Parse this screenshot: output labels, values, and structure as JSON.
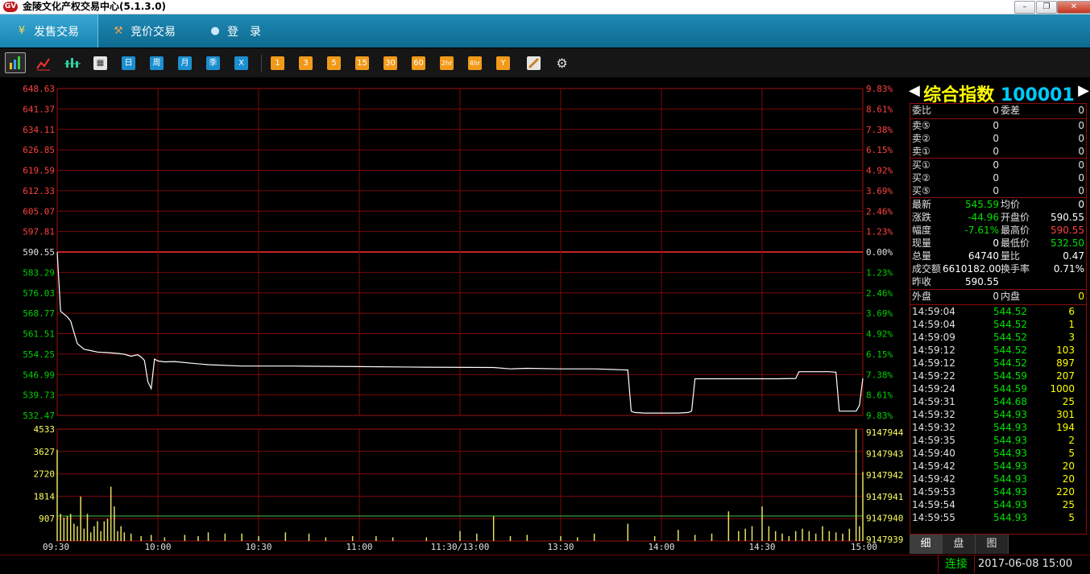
{
  "window": {
    "title": "金陵文化产权交易中心(5.1.3.0)"
  },
  "nav": {
    "tabs": [
      {
        "label": "发售交易",
        "icon": "yen-icon"
      },
      {
        "label": "竞价交易",
        "icon": "gavel-icon"
      },
      {
        "label": "登　录",
        "icon": "user-icon"
      }
    ]
  },
  "toolbar": {
    "periods": [
      "日",
      "周",
      "月",
      "季",
      "X"
    ],
    "minutes": [
      "1",
      "3",
      "5",
      "15",
      "30",
      "60",
      "2hr",
      "4hr",
      "Y"
    ]
  },
  "chart_data": {
    "type": "line",
    "price_axis": {
      "left_labels": [
        "648.63",
        "641.37",
        "634.11",
        "626.85",
        "619.59",
        "612.33",
        "605.07",
        "597.81",
        "590.55",
        "583.29",
        "576.03",
        "568.77",
        "561.51",
        "554.25",
        "546.99",
        "539.73",
        "532.47"
      ],
      "right_labels": [
        "9.83%",
        "8.61%",
        "7.38%",
        "6.15%",
        "4.92%",
        "3.69%",
        "2.46%",
        "1.23%",
        "0.00%",
        "1.23%",
        "2.46%",
        "3.69%",
        "4.92%",
        "6.15%",
        "7.38%",
        "8.61%",
        "9.83%"
      ],
      "ylim": [
        532.47,
        648.63
      ],
      "prev_close": 590.55
    },
    "volume_axis": {
      "left_labels": [
        "4533",
        "3627",
        "2720",
        "1814",
        "907"
      ],
      "right_labels": [
        "9147944",
        "9147943",
        "9147942",
        "9147941",
        "9147940",
        "9147939"
      ],
      "ylim": [
        0,
        4533
      ]
    },
    "x_labels": [
      "09:30",
      "10:00",
      "10:30",
      "11:00",
      "11:30/13:00",
      "13:30",
      "14:00",
      "14:30",
      "15:00"
    ],
    "n_minutes": 240,
    "price_series": [
      [
        0,
        590.5
      ],
      [
        1,
        569.5
      ],
      [
        2,
        568.5
      ],
      [
        3,
        567.5
      ],
      [
        4,
        566
      ],
      [
        5,
        562
      ],
      [
        6,
        558
      ],
      [
        8,
        556
      ],
      [
        10,
        555.5
      ],
      [
        12,
        555
      ],
      [
        15,
        554.8
      ],
      [
        18,
        554.5
      ],
      [
        20,
        554.2
      ],
      [
        22,
        553.5
      ],
      [
        24,
        554
      ],
      [
        25,
        553.2
      ],
      [
        26,
        552
      ],
      [
        27,
        544.5
      ],
      [
        28,
        542
      ],
      [
        29,
        552.5
      ],
      [
        30,
        551.8
      ],
      [
        32,
        551.5
      ],
      [
        35,
        551.6
      ],
      [
        40,
        551
      ],
      [
        45,
        550.5
      ],
      [
        55,
        550
      ],
      [
        70,
        550
      ],
      [
        90,
        549.8
      ],
      [
        110,
        549.6
      ],
      [
        130,
        549.5
      ],
      [
        135,
        549
      ],
      [
        140,
        549.2
      ],
      [
        150,
        549
      ],
      [
        160,
        549
      ],
      [
        168,
        548.7
      ],
      [
        170,
        548.6
      ],
      [
        171,
        534
      ],
      [
        172,
        533.5
      ],
      [
        175,
        533.3
      ],
      [
        185,
        533.3
      ],
      [
        188,
        533.5
      ],
      [
        189,
        534
      ],
      [
        190,
        545.5
      ],
      [
        200,
        545.5
      ],
      [
        215,
        545.5
      ],
      [
        220,
        545.6
      ],
      [
        221,
        548
      ],
      [
        230,
        548
      ],
      [
        232,
        547.8
      ],
      [
        233,
        534
      ],
      [
        238,
        534
      ],
      [
        239,
        536
      ],
      [
        240,
        545.6
      ]
    ],
    "volume_series": [
      [
        0,
        3700
      ],
      [
        1,
        1100
      ],
      [
        2,
        950
      ],
      [
        3,
        1000
      ],
      [
        4,
        1100
      ],
      [
        5,
        700
      ],
      [
        6,
        600
      ],
      [
        7,
        1800
      ],
      [
        8,
        500
      ],
      [
        9,
        1100
      ],
      [
        10,
        350
      ],
      [
        11,
        600
      ],
      [
        12,
        800
      ],
      [
        13,
        400
      ],
      [
        14,
        800
      ],
      [
        15,
        900
      ],
      [
        16,
        2200
      ],
      [
        17,
        1400
      ],
      [
        18,
        400
      ],
      [
        19,
        600
      ],
      [
        20,
        350
      ],
      [
        22,
        300
      ],
      [
        25,
        200
      ],
      [
        28,
        250
      ],
      [
        32,
        150
      ],
      [
        38,
        250
      ],
      [
        42,
        200
      ],
      [
        45,
        350
      ],
      [
        50,
        300
      ],
      [
        55,
        300
      ],
      [
        60,
        200
      ],
      [
        68,
        350
      ],
      [
        75,
        300
      ],
      [
        80,
        150
      ],
      [
        88,
        200
      ],
      [
        95,
        200
      ],
      [
        100,
        150
      ],
      [
        110,
        150
      ],
      [
        120,
        400
      ],
      [
        125,
        300
      ],
      [
        130,
        1000
      ],
      [
        135,
        200
      ],
      [
        140,
        250
      ],
      [
        150,
        200
      ],
      [
        155,
        150
      ],
      [
        160,
        300
      ],
      [
        170,
        700
      ],
      [
        178,
        200
      ],
      [
        185,
        450
      ],
      [
        190,
        250
      ],
      [
        195,
        300
      ],
      [
        200,
        1200
      ],
      [
        203,
        400
      ],
      [
        205,
        500
      ],
      [
        207,
        600
      ],
      [
        210,
        1400
      ],
      [
        212,
        600
      ],
      [
        214,
        400
      ],
      [
        216,
        300
      ],
      [
        218,
        200
      ],
      [
        220,
        400
      ],
      [
        222,
        500
      ],
      [
        224,
        400
      ],
      [
        226,
        300
      ],
      [
        228,
        600
      ],
      [
        230,
        400
      ],
      [
        232,
        350
      ],
      [
        234,
        300
      ],
      [
        236,
        500
      ],
      [
        238,
        4533
      ],
      [
        239,
        600
      ],
      [
        240,
        2800
      ]
    ]
  },
  "quote_panel": {
    "name": "综合指数",
    "code": "100001",
    "weibi_label": "委比",
    "weibi": "0",
    "weicha_label": "委差",
    "weicha": "0",
    "sells": [
      {
        "label": "卖⑤",
        "price": "0",
        "vol": "0"
      },
      {
        "label": "卖②",
        "price": "0",
        "vol": "0"
      },
      {
        "label": "卖①",
        "price": "0",
        "vol": "0"
      }
    ],
    "buys": [
      {
        "label": "买①",
        "price": "0",
        "vol": "0"
      },
      {
        "label": "买②",
        "price": "0",
        "vol": "0"
      },
      {
        "label": "买⑤",
        "price": "0",
        "vol": "0"
      }
    ],
    "stats": [
      [
        "最新",
        "545.59",
        "均价",
        "0"
      ],
      [
        "涨跌",
        "-44.96",
        "开盘价",
        "590.55"
      ],
      [
        "幅度",
        "-7.61%",
        "最高价",
        "590.55"
      ],
      [
        "现量",
        "0",
        "最低价",
        "532.50"
      ],
      [
        "总量",
        "64740",
        "量比",
        "0.47"
      ],
      [
        "成交额",
        "6610182.00",
        "换手率",
        "0.71%"
      ],
      [
        "昨收",
        "590.55",
        "",
        ""
      ]
    ],
    "waipan_label": "外盘",
    "waipan": "0",
    "neipan_label": "内盘",
    "neipan": "0",
    "ticks": [
      [
        "14:59:04",
        "544.52",
        "6"
      ],
      [
        "14:59:04",
        "544.52",
        "1"
      ],
      [
        "14:59:09",
        "544.52",
        "3"
      ],
      [
        "14:59:12",
        "544.52",
        "103"
      ],
      [
        "14:59:12",
        "544.52",
        "897"
      ],
      [
        "14:59:22",
        "544.59",
        "207"
      ],
      [
        "14:59:24",
        "544.59",
        "1000"
      ],
      [
        "14:59:31",
        "544.68",
        "25"
      ],
      [
        "14:59:32",
        "544.93",
        "301"
      ],
      [
        "14:59:32",
        "544.93",
        "194"
      ],
      [
        "14:59:35",
        "544.93",
        "2"
      ],
      [
        "14:59:40",
        "544.93",
        "5"
      ],
      [
        "14:59:42",
        "544.93",
        "20"
      ],
      [
        "14:59:42",
        "544.93",
        "20"
      ],
      [
        "14:59:53",
        "544.93",
        "220"
      ],
      [
        "14:59:54",
        "544.93",
        "25"
      ],
      [
        "14:59:55",
        "544.93",
        "5"
      ]
    ],
    "bottom_tabs": [
      "细",
      "盘",
      "图"
    ]
  },
  "status": {
    "connection": "连接",
    "datetime": "2017-06-08 15:00"
  }
}
